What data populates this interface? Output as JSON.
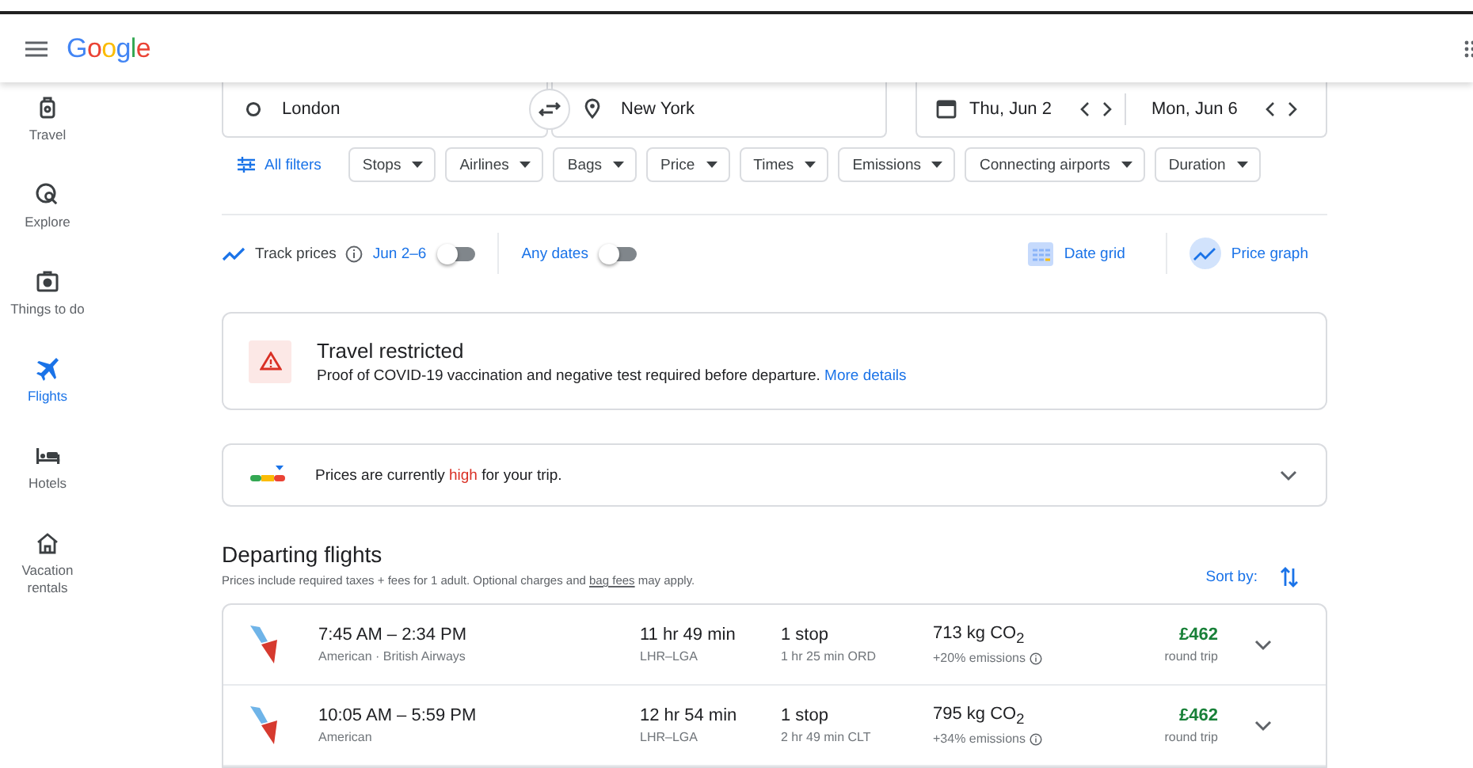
{
  "header": {
    "logo": "Google"
  },
  "sidebar": {
    "items": [
      {
        "kind": "luggage",
        "label": "Travel",
        "selected": false
      },
      {
        "kind": "explore",
        "label": "Explore",
        "selected": false
      },
      {
        "kind": "things",
        "label": "Things to do",
        "selected": false
      },
      {
        "kind": "flight",
        "label": "Flights",
        "selected": true
      },
      {
        "kind": "hotel",
        "label": "Hotels",
        "selected": false
      },
      {
        "kind": "home",
        "label": "Vacation rentals",
        "selected": false
      }
    ]
  },
  "search": {
    "origin": "London",
    "destination": "New York",
    "depart": "Thu, Jun 2",
    "return": "Mon, Jun 6"
  },
  "filters": {
    "all": "All filters",
    "chips": [
      "Stops",
      "Airlines",
      "Bags",
      "Price",
      "Times",
      "Emissions",
      "Connecting airports",
      "Duration"
    ]
  },
  "tracking": {
    "label": "Track prices",
    "dates": "Jun 2–6",
    "on": false,
    "any_dates": "Any dates",
    "any_on": false,
    "date_grid": "Date grid",
    "price_graph": "Price graph"
  },
  "restriction": {
    "title": "Travel restricted",
    "body": "Proof of COVID-19 vaccination and negative test required before departure.",
    "link": "More details"
  },
  "price_insight": {
    "before": "Prices are currently ",
    "level": "high",
    "after": " for your trip."
  },
  "departing": {
    "title": "Departing flights",
    "note_before": "Prices include required taxes + fees for 1 adult. Optional charges and ",
    "note_link": "bag fees",
    "note_after": " may apply.",
    "sort": "Sort by:"
  },
  "flights": [
    {
      "times": "7:45 AM – 2:34 PM",
      "airlines": "American · British Airways",
      "duration": "11 hr 49 min",
      "route": "LHR–LGA",
      "stops": "1 stop",
      "layover": "1 hr 25 min ORD",
      "co2": "713 kg CO$_{2}$",
      "emissions": "+20% emissions",
      "price": "£462",
      "trip": "round trip"
    },
    {
      "times": "10:05 AM – 5:59 PM",
      "airlines": "American",
      "duration": "12 hr 54 min",
      "route": "LHR–LGA",
      "stops": "1 stop",
      "layover": "2 hr 49 min CLT",
      "co2": "795 kg CO$_{2}$",
      "emissions": "+34% emissions",
      "price": "£462",
      "trip": "round trip"
    }
  ]
}
